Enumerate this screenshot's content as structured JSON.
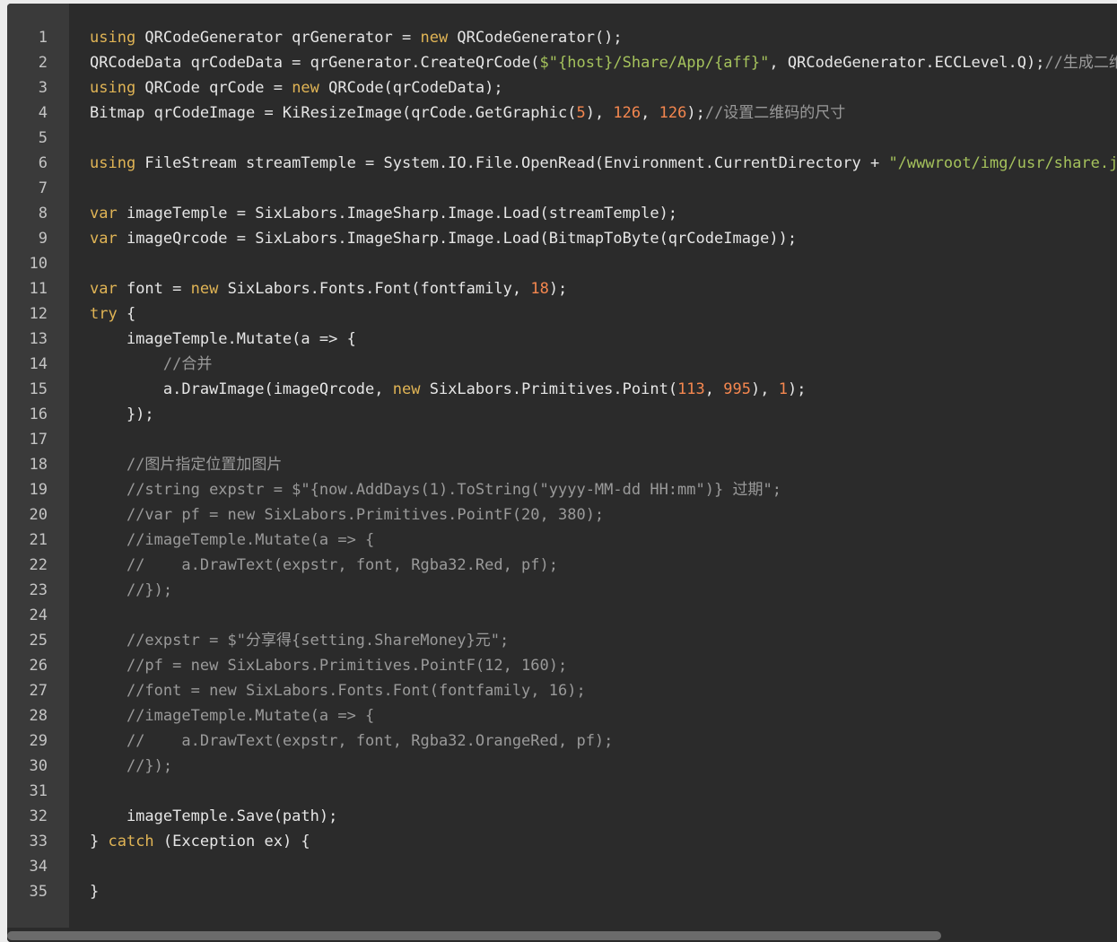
{
  "colors": {
    "editor_bg": "#2b2b2b",
    "gutter_bg": "#3a3a3a",
    "keyword": "#e0b455",
    "string": "#a5c25c",
    "number": "#f5874f",
    "comment": "#9a9a9a",
    "text": "#e6e6e6"
  },
  "line_numbers": [
    "1",
    "2",
    "3",
    "4",
    "5",
    "6",
    "7",
    "8",
    "9",
    "10",
    "11",
    "12",
    "13",
    "14",
    "15",
    "16",
    "17",
    "18",
    "19",
    "20",
    "21",
    "22",
    "23",
    "24",
    "25",
    "26",
    "27",
    "28",
    "29",
    "30",
    "31",
    "32",
    "33",
    "34",
    "35"
  ],
  "code_lines": [
    [
      [
        "kw",
        "using"
      ],
      [
        "txt",
        " QRCodeGenerator qrGenerator = "
      ],
      [
        "kw",
        "new"
      ],
      [
        "txt",
        " QRCodeGenerator();"
      ]
    ],
    [
      [
        "txt",
        "QRCodeData qrCodeData = qrGenerator.CreateQrCode("
      ],
      [
        "str",
        "$\"{host}/Share/App/{aff}\""
      ],
      [
        "txt",
        ", QRCodeGenerator.ECCLevel.Q);"
      ],
      [
        "cmt",
        "//生成二维码"
      ]
    ],
    [
      [
        "kw",
        "using"
      ],
      [
        "txt",
        " QRCode qrCode = "
      ],
      [
        "kw",
        "new"
      ],
      [
        "txt",
        " QRCode(qrCodeData);"
      ]
    ],
    [
      [
        "txt",
        "Bitmap qrCodeImage = KiResizeImage(qrCode.GetGraphic("
      ],
      [
        "num",
        "5"
      ],
      [
        "txt",
        "), "
      ],
      [
        "num",
        "126"
      ],
      [
        "txt",
        ", "
      ],
      [
        "num",
        "126"
      ],
      [
        "txt",
        ");"
      ],
      [
        "cmt",
        "//设置二维码的尺寸"
      ]
    ],
    [],
    [
      [
        "kw",
        "using"
      ],
      [
        "txt",
        " FileStream streamTemple = System.IO.File.OpenRead(Environment.CurrentDirectory + "
      ],
      [
        "str",
        "\"/wwwroot/img/usr/share.jpg\""
      ],
      [
        "txt",
        ");"
      ]
    ],
    [],
    [
      [
        "kw",
        "var"
      ],
      [
        "txt",
        " imageTemple = SixLabors.ImageSharp.Image.Load(streamTemple);"
      ]
    ],
    [
      [
        "kw",
        "var"
      ],
      [
        "txt",
        " imageQrcode = SixLabors.ImageSharp.Image.Load(BitmapToByte(qrCodeImage));"
      ]
    ],
    [],
    [
      [
        "kw",
        "var"
      ],
      [
        "txt",
        " font = "
      ],
      [
        "kw",
        "new"
      ],
      [
        "txt",
        " SixLabors.Fonts.Font(fontfamily, "
      ],
      [
        "num",
        "18"
      ],
      [
        "txt",
        ");"
      ]
    ],
    [
      [
        "kw",
        "try"
      ],
      [
        "txt",
        " {"
      ]
    ],
    [
      [
        "txt",
        "    imageTemple.Mutate(a => {"
      ]
    ],
    [
      [
        "txt",
        "        "
      ],
      [
        "cmt",
        "//合并"
      ]
    ],
    [
      [
        "txt",
        "        a.DrawImage(imageQrcode, "
      ],
      [
        "kw",
        "new"
      ],
      [
        "txt",
        " SixLabors.Primitives.Point("
      ],
      [
        "num",
        "113"
      ],
      [
        "txt",
        ", "
      ],
      [
        "num",
        "995"
      ],
      [
        "txt",
        "), "
      ],
      [
        "num",
        "1"
      ],
      [
        "txt",
        ");"
      ]
    ],
    [
      [
        "txt",
        "    });"
      ]
    ],
    [],
    [
      [
        "txt",
        "    "
      ],
      [
        "cmt",
        "//图片指定位置加图片"
      ]
    ],
    [
      [
        "txt",
        "    "
      ],
      [
        "cmt",
        "//string expstr = $\"{now.AddDays(1).ToString(\"yyyy-MM-dd HH:mm\")} 过期\";"
      ]
    ],
    [
      [
        "txt",
        "    "
      ],
      [
        "cmt",
        "//var pf = new SixLabors.Primitives.PointF(20, 380);"
      ]
    ],
    [
      [
        "txt",
        "    "
      ],
      [
        "cmt",
        "//imageTemple.Mutate(a => {"
      ]
    ],
    [
      [
        "txt",
        "    "
      ],
      [
        "cmt",
        "//    a.DrawText(expstr, font, Rgba32.Red, pf);"
      ]
    ],
    [
      [
        "txt",
        "    "
      ],
      [
        "cmt",
        "//});"
      ]
    ],
    [],
    [
      [
        "txt",
        "    "
      ],
      [
        "cmt",
        "//expstr = $\"分享得{setting.ShareMoney}元\";"
      ]
    ],
    [
      [
        "txt",
        "    "
      ],
      [
        "cmt",
        "//pf = new SixLabors.Primitives.PointF(12, 160);"
      ]
    ],
    [
      [
        "txt",
        "    "
      ],
      [
        "cmt",
        "//font = new SixLabors.Fonts.Font(fontfamily, 16);"
      ]
    ],
    [
      [
        "txt",
        "    "
      ],
      [
        "cmt",
        "//imageTemple.Mutate(a => {"
      ]
    ],
    [
      [
        "txt",
        "    "
      ],
      [
        "cmt",
        "//    a.DrawText(expstr, font, Rgba32.OrangeRed, pf);"
      ]
    ],
    [
      [
        "txt",
        "    "
      ],
      [
        "cmt",
        "//});"
      ]
    ],
    [],
    [
      [
        "txt",
        "    imageTemple.Save(path);"
      ]
    ],
    [
      [
        "txt",
        "} "
      ],
      [
        "kw",
        "catch"
      ],
      [
        "txt",
        " (Exception ex) {"
      ]
    ],
    [],
    [
      [
        "txt",
        "}"
      ]
    ]
  ]
}
